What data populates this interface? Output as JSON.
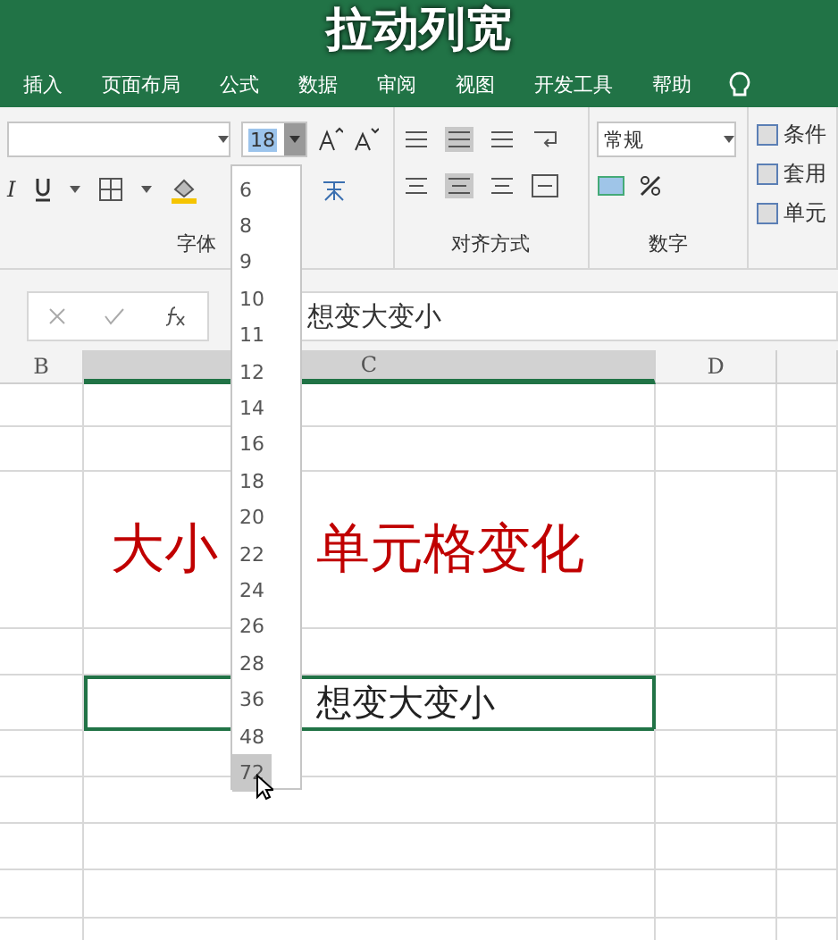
{
  "title": "拉动列宽",
  "tabs": [
    {
      "label": "插入",
      "selected": false
    },
    {
      "label": "页面布局",
      "selected": false
    },
    {
      "label": "公式",
      "selected": false
    },
    {
      "label": "数据",
      "selected": false
    },
    {
      "label": "审阅",
      "selected": false
    },
    {
      "label": "视图",
      "selected": false
    },
    {
      "label": "开发工具",
      "selected": false
    },
    {
      "label": "帮助",
      "selected": false
    }
  ],
  "ribbon": {
    "italic": "I",
    "font_size": "18",
    "font_group_label": "字体",
    "align_group_label": "对齐方式",
    "number_format": "常规",
    "number_group_label": "数字",
    "style_buttons": [
      "条件",
      "套用",
      "单元"
    ]
  },
  "font_size_options": [
    {
      "label": "6",
      "selected": false
    },
    {
      "label": "8",
      "selected": false
    },
    {
      "label": "9",
      "selected": false
    },
    {
      "label": "10",
      "selected": false
    },
    {
      "label": "11",
      "selected": false
    },
    {
      "label": "12",
      "selected": false
    },
    {
      "label": "14",
      "selected": false
    },
    {
      "label": "16",
      "selected": false
    },
    {
      "label": "18",
      "selected": false
    },
    {
      "label": "20",
      "selected": false
    },
    {
      "label": "22",
      "selected": false
    },
    {
      "label": "24",
      "selected": false
    },
    {
      "label": "26",
      "selected": false
    },
    {
      "label": "28",
      "selected": false
    },
    {
      "label": "36",
      "selected": false
    },
    {
      "label": "48",
      "selected": false
    },
    {
      "label": "72",
      "selected": true
    }
  ],
  "formula_bar": {
    "value": "想变大变小"
  },
  "columns": [
    {
      "label": "B",
      "selected": false
    },
    {
      "label": "C",
      "selected": true
    },
    {
      "label": "D",
      "selected": false
    }
  ],
  "cells": [
    {
      "kind": "big",
      "parts": [
        "大小",
        "单元格变化"
      ],
      "selected": false
    },
    {
      "kind": "normal",
      "parts": [
        "想变大变小"
      ],
      "selected": true
    }
  ]
}
